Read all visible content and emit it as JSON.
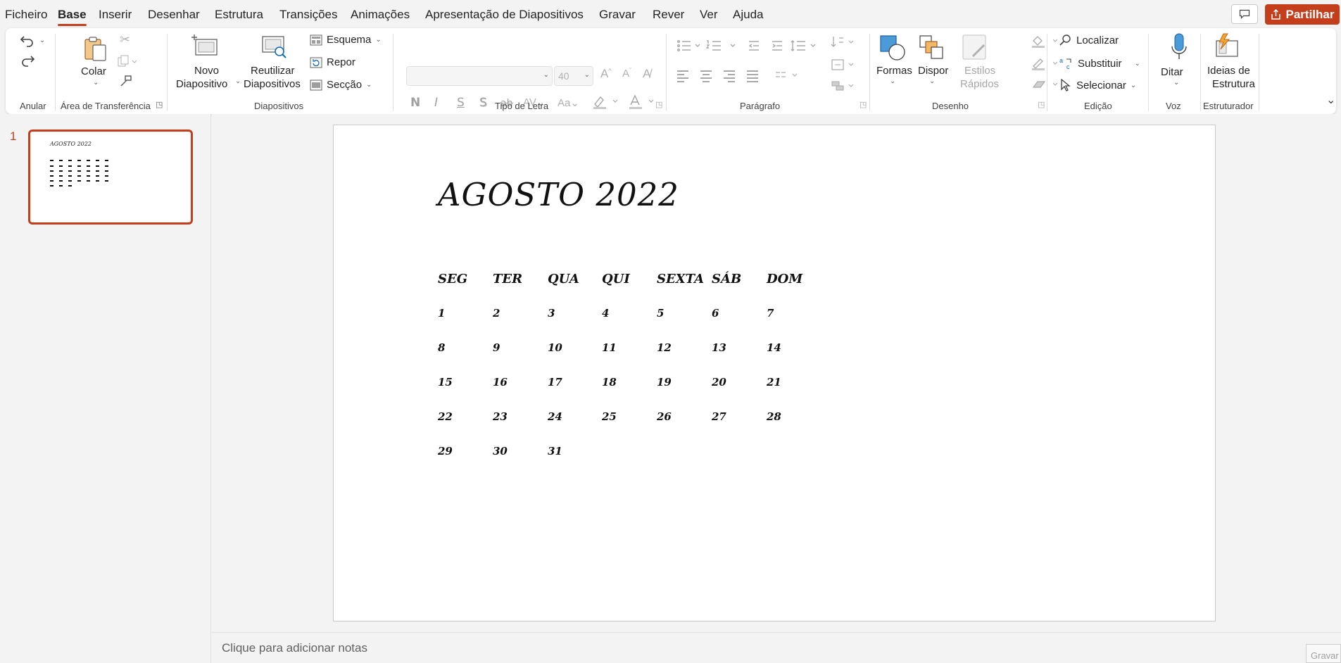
{
  "menu": {
    "tabs": [
      "Ficheiro",
      "Base",
      "Inserir",
      "Desenhar",
      "Estrutura",
      "Transições",
      "Animações",
      "Apresentação de Diapositivos",
      "Gravar",
      "Rever",
      "Ver",
      "Ajuda"
    ],
    "active_tab": "Base",
    "share_label": "Partilhar"
  },
  "ribbon": {
    "groups": {
      "undo": "Anular",
      "clipboard": "Área de Transferência",
      "slides": "Diapositivos",
      "font": "Tipo de Letra",
      "paragraph": "Parágrafo",
      "drawing": "Desenho",
      "editing": "Edição",
      "voice": "Voz",
      "designer": "Estruturador"
    },
    "paste": "Colar",
    "new_slide_1": "Novo",
    "new_slide_2": "Diapositivo",
    "reuse_1": "Reutilizar",
    "reuse_2": "Diapositivos",
    "layout": "Esquema",
    "reset": "Repor",
    "section": "Secção",
    "font_size": "40",
    "bold": "N",
    "italic": "I",
    "underline": "S",
    "shadow": "S",
    "strike": "ab",
    "shapes": "Formas",
    "arrange": "Dispor",
    "quick_styles_1": "Estilos",
    "quick_styles_2": "Rápidos",
    "find": "Localizar",
    "replace": "Substituir",
    "select": "Selecionar",
    "dictate": "Ditar",
    "design_ideas_1": "Ideias de",
    "design_ideas_2": "Estrutura"
  },
  "slides_panel": {
    "slide_number": "1",
    "thumb_title": "AGOSTO 2022"
  },
  "slide": {
    "title": "AGOSTO 2022",
    "weekdays": [
      "SEG",
      "TER",
      "QUA",
      "QUI",
      "SEXTA",
      "SÁB",
      "DOM"
    ],
    "weeks": [
      [
        "1",
        "2",
        "3",
        "4",
        "5",
        "6",
        "7"
      ],
      [
        "8",
        "9",
        "10",
        "11",
        "12",
        "13",
        "14"
      ],
      [
        "15",
        "16",
        "17",
        "18",
        "19",
        "20",
        "21"
      ],
      [
        "22",
        "23",
        "24",
        "25",
        "26",
        "27",
        "28"
      ],
      [
        "29",
        "30",
        "31",
        "",
        "",
        "",
        ""
      ]
    ]
  },
  "notes": {
    "placeholder": "Clique para adicionar notas"
  },
  "status": {
    "record_label": "Gravar"
  },
  "colors": {
    "accent": "#c43e1c"
  }
}
